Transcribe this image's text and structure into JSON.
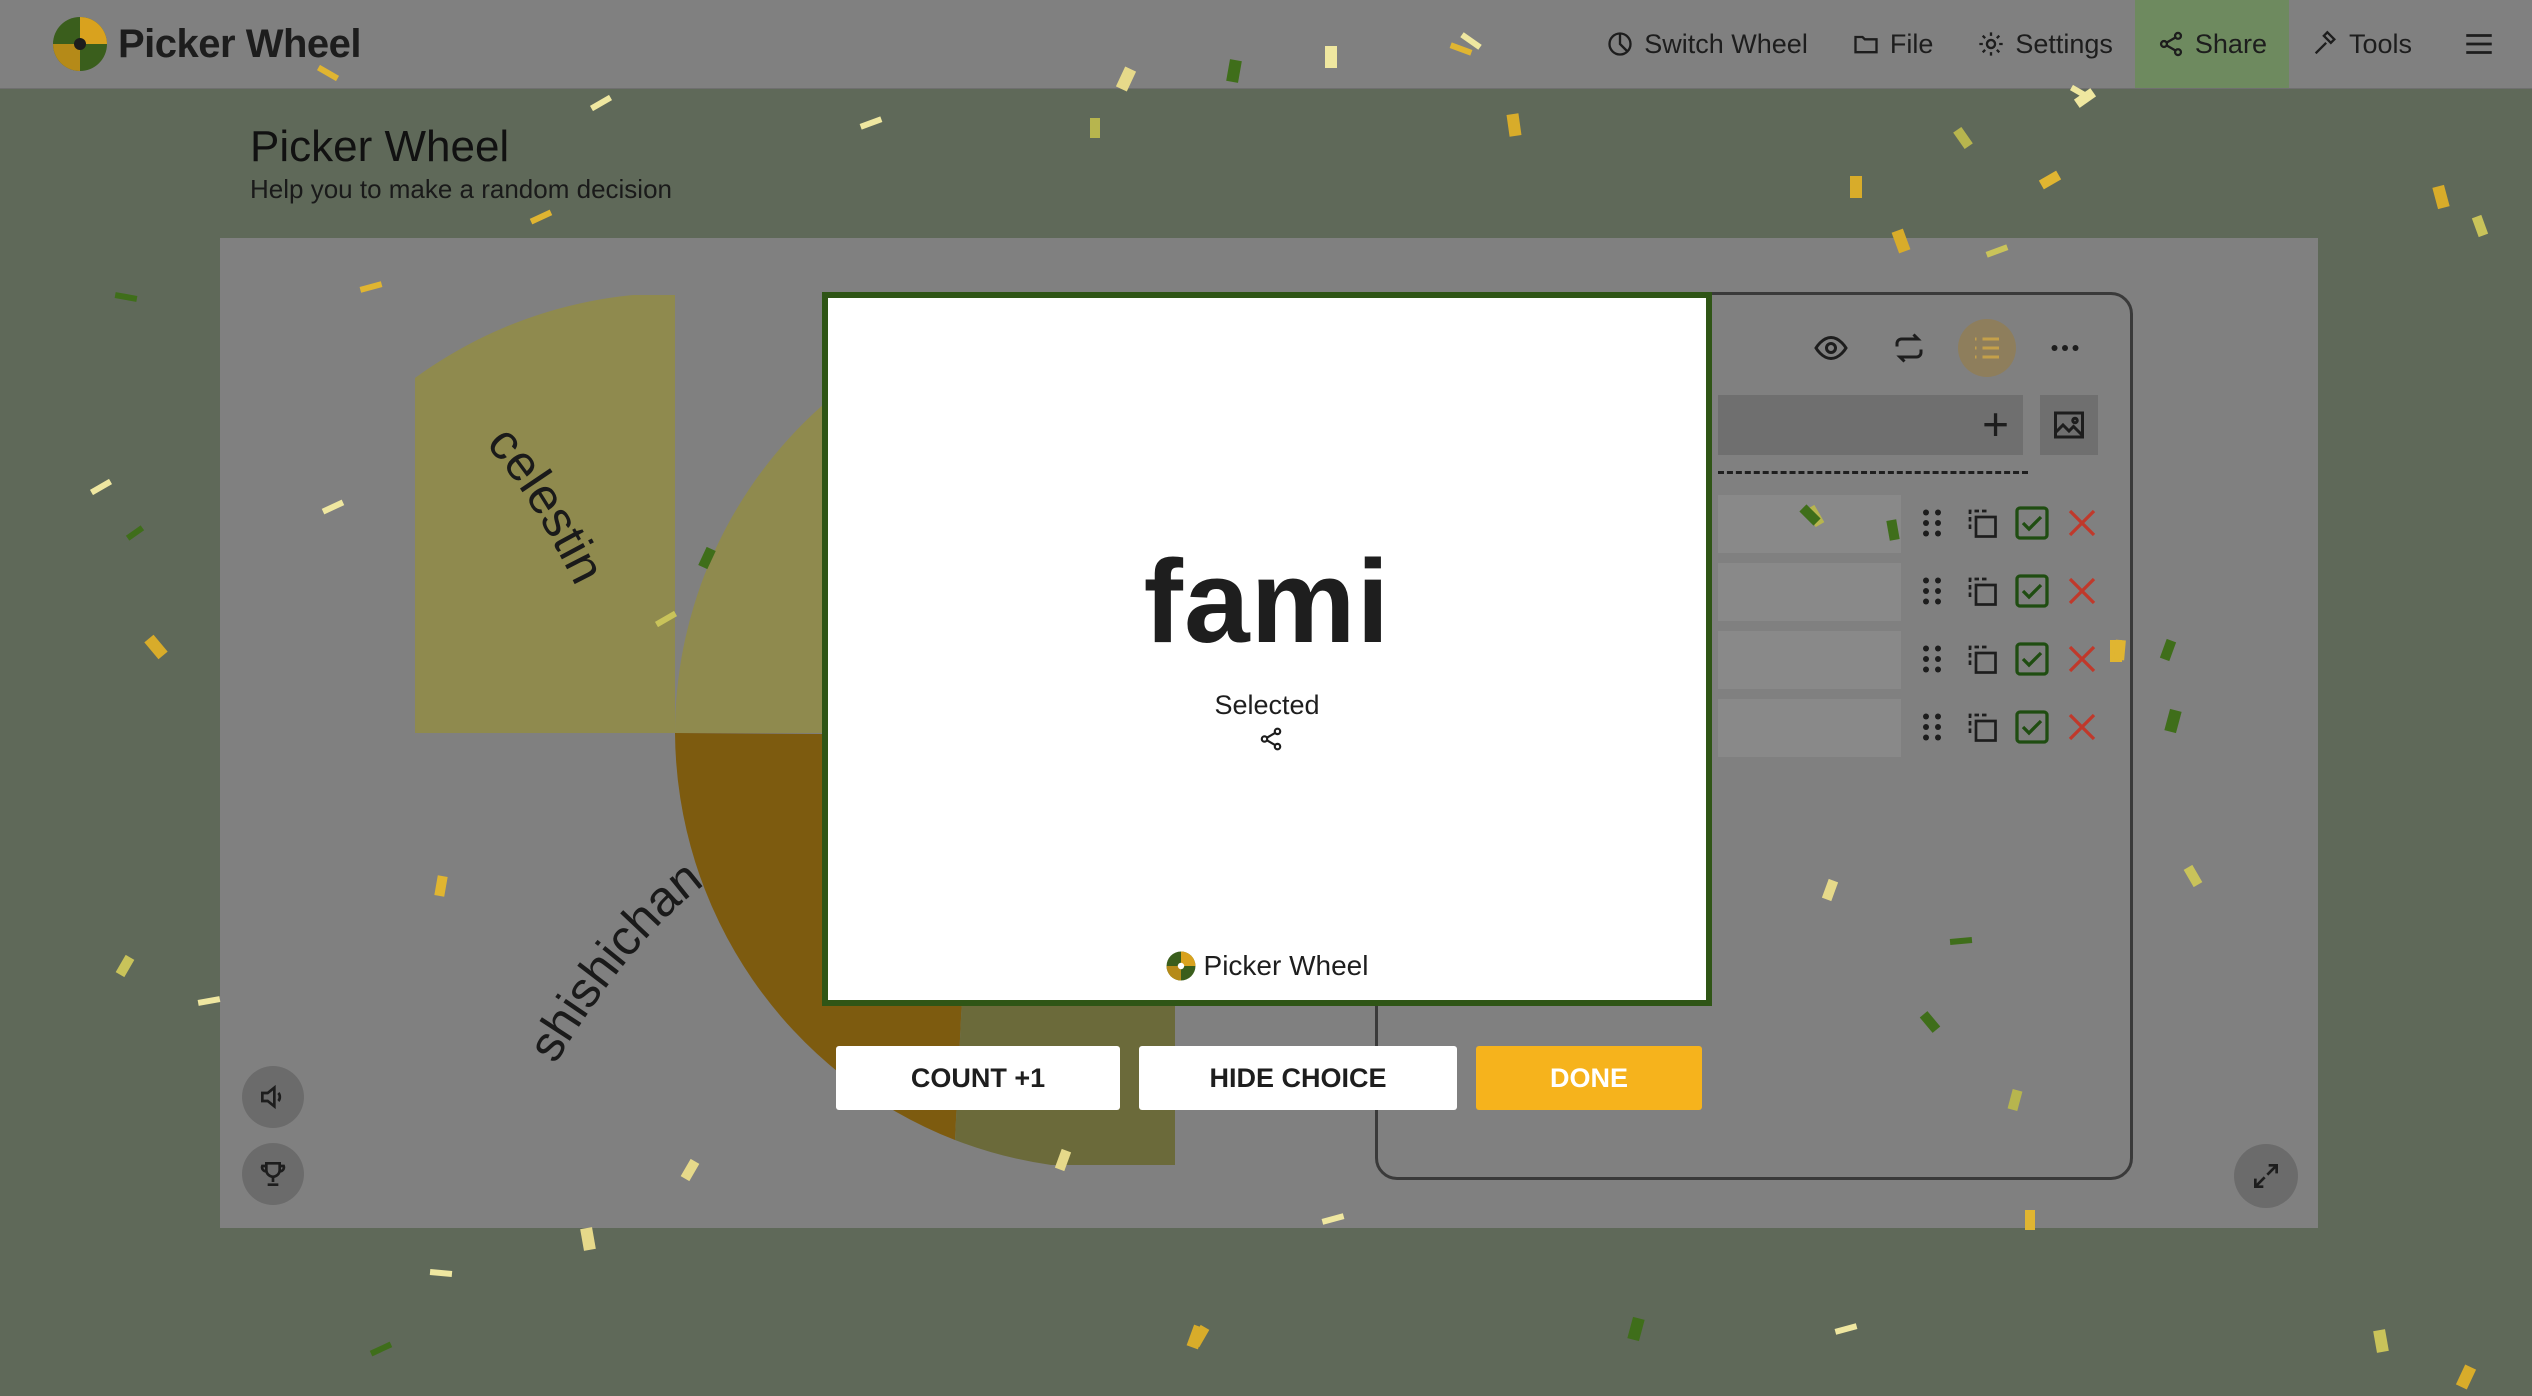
{
  "brand": {
    "name": "Picker Wheel"
  },
  "nav": {
    "switch_wheel": "Switch Wheel",
    "file": "File",
    "settings": "Settings",
    "share": "Share",
    "tools": "Tools"
  },
  "page": {
    "title": "Picker Wheel",
    "subtitle": "Help you to make a random decision"
  },
  "wheel": {
    "segments": [
      {
        "label": "celestine",
        "color": "#8f8a4e"
      },
      {
        "label": "shishichan",
        "color": "#7d5b0f"
      }
    ]
  },
  "modal": {
    "result": "fami",
    "status": "Selected",
    "brand": "Picker Wheel",
    "border_color": "#2f5516"
  },
  "actions": {
    "count": "COUNT +1",
    "hide": "HIDE CHOICE",
    "done": "DONE",
    "done_color": "#f6b31c"
  },
  "entries": {
    "row_count": 4
  },
  "colors": {
    "accent_green": "#2f5516",
    "accent_yellow": "#f6b31c",
    "delete_red": "#c0392b"
  }
}
